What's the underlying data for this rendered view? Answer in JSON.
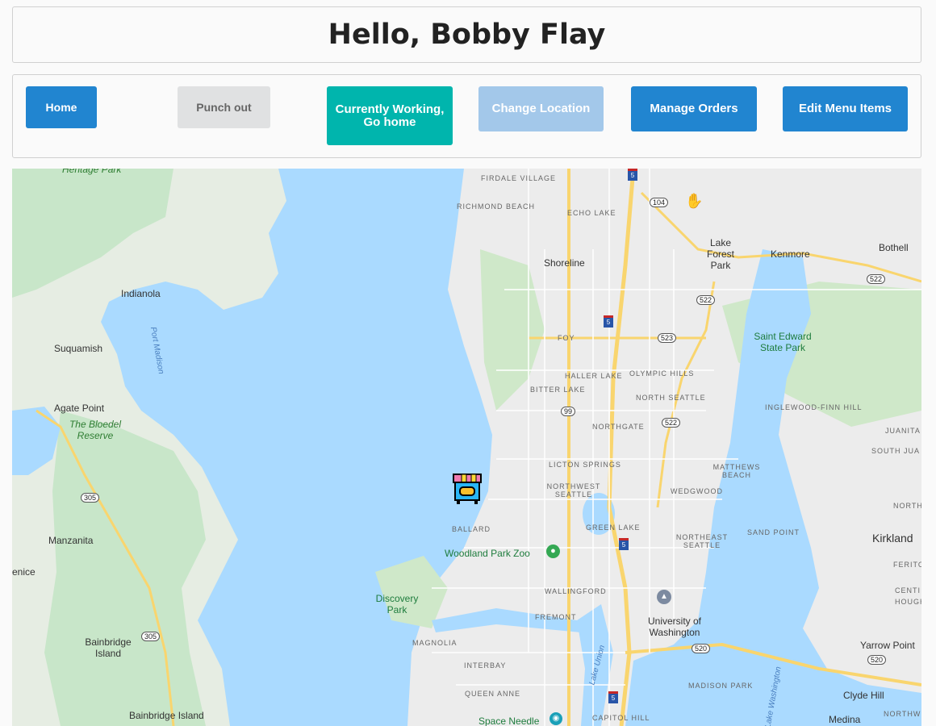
{
  "header": {
    "greeting": "Hello, Bobby Flay"
  },
  "nav": {
    "home": "Home",
    "punch_out": "Punch out",
    "working": "Currently Working, Go home",
    "change_location": "Change Location",
    "manage_orders": "Manage Orders",
    "edit_menu": "Edit Menu Items"
  },
  "map": {
    "cities": [
      "Indianola",
      "Suquamish",
      "Agate Point",
      "Manzanita",
      "Bainbridge Island",
      "Shoreline",
      "Lake Forest Park",
      "Kenmore",
      "Bothell",
      "Kirkland",
      "Yarrow Point",
      "Clyde Hill",
      "Medina",
      "Bainbridge Island",
      "enice"
    ],
    "neighborhoods": [
      "FIRDALE VILLAGE",
      "RICHMOND BEACH",
      "ECHO LAKE",
      "FOY",
      "HALLER LAKE",
      "OLYMPIC HILLS",
      "BITTER LAKE",
      "NORTH SEATTLE",
      "NORTHGATE",
      "INGLEWOOD-FINN HILL",
      "LICTON SPRINGS",
      "NORTHWEST SEATTLE",
      "MATTHEWS BEACH",
      "WEDGWOOD",
      "JUANITA",
      "SOUTH JUA",
      "BALLARD",
      "GREEN LAKE",
      "NORTHEAST SEATTLE",
      "SAND POINT",
      "WALLINGFORD",
      "FREMONT",
      "MAGNOLIA",
      "INTERBAY",
      "QUEEN ANNE",
      "MADISON PARK",
      "CAPITOL HILL",
      "NORTHWE",
      "NORTHW",
      "FERITO",
      "CENTI",
      "HOUGH"
    ],
    "parks": [
      "The Bloedel Reserve",
      "Saint Edward State Park",
      "Discovery Park",
      "Woodland Park Zoo",
      "University of Washington",
      "Space Needle",
      "Heritage Park"
    ],
    "water": [
      "Port Madison",
      "Lake Union",
      "Lake Washington"
    ],
    "highways": [
      "104",
      "522",
      "523",
      "99",
      "305",
      "520",
      "5"
    ]
  }
}
